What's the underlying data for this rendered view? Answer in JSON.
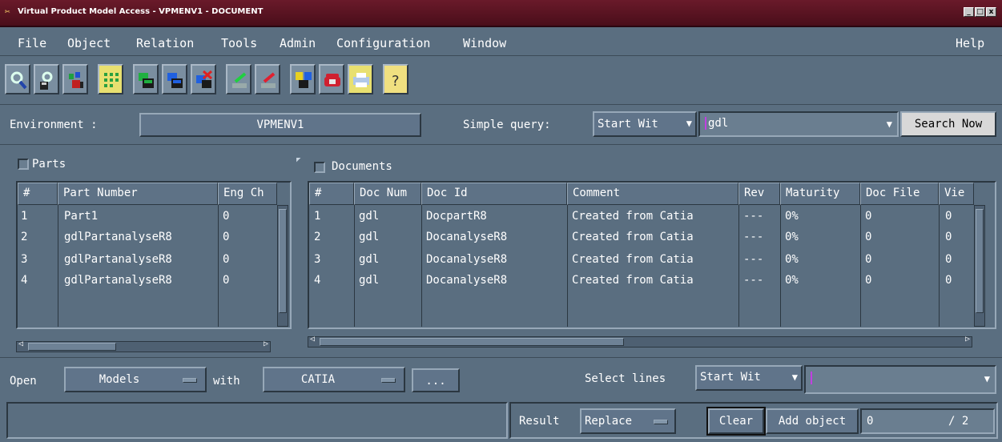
{
  "window": {
    "title": "Virtual Product Model Access - VPMENV1 - DOCUMENT",
    "min": "_",
    "max": "□",
    "close": "x"
  },
  "menubar": {
    "items": [
      "File",
      "Object",
      "Relation",
      "Tools",
      "Admin",
      "Configuration",
      "Window"
    ],
    "help": "Help"
  },
  "toolbar": {
    "icons": [
      "search-icon",
      "search-save-icon",
      "users-icon",
      "grid-icon",
      "tree-icon",
      "expand-tree-icon",
      "delete-tree-icon",
      "green-check-icon",
      "red-edit-icon",
      "compare-icon",
      "phone-icon",
      "print-icon",
      "help-icon"
    ]
  },
  "environment": {
    "label": "Environment :",
    "value": "VPMENV1"
  },
  "query": {
    "label": "Simple query:",
    "mode": "Start Wit",
    "value": "gdl",
    "search_button": "Search Now"
  },
  "parts": {
    "title": "Parts",
    "columns": [
      "#",
      "Part Number",
      "Eng Ch"
    ],
    "rows": [
      [
        "1",
        "Part1",
        "0"
      ],
      [
        "2",
        "gdlPartanalyseR8",
        "0"
      ],
      [
        "3",
        "gdlPartanalyseR8",
        "0"
      ],
      [
        "4",
        "gdlPartanalyseR8",
        "0"
      ]
    ]
  },
  "documents": {
    "title": "Documents",
    "columns": [
      "#",
      "Doc Num",
      "Doc Id",
      "Comment",
      "Rev",
      "Maturity",
      "Doc File",
      "Vie"
    ],
    "rows": [
      [
        "1",
        "gdl",
        "DocpartR8",
        "Created from Catia",
        "---",
        "0%",
        "0",
        "0"
      ],
      [
        "2",
        "gdl",
        "DocanalyseR8",
        "Created from Catia",
        "---",
        "0%",
        "0",
        "0"
      ],
      [
        "3",
        "gdl",
        "DocanalyseR8",
        "Created from Catia",
        "---",
        "0%",
        "0",
        "0"
      ],
      [
        "4",
        "gdl",
        "DocanalyseR8",
        "Created from Catia",
        "---",
        "0%",
        "0",
        "0"
      ]
    ]
  },
  "open_bar": {
    "open_label": "Open",
    "models": "Models",
    "with_label": "with",
    "catia": "CATIA",
    "more": "...",
    "select_lines_label": "Select lines",
    "select_mode": "Start Wit",
    "select_value": ""
  },
  "status_bar": {
    "message": "",
    "result_label": "Result",
    "result_mode": "Replace",
    "clear": "Clear",
    "add_object": "Add object",
    "count": "0",
    "total": "/ 2"
  }
}
